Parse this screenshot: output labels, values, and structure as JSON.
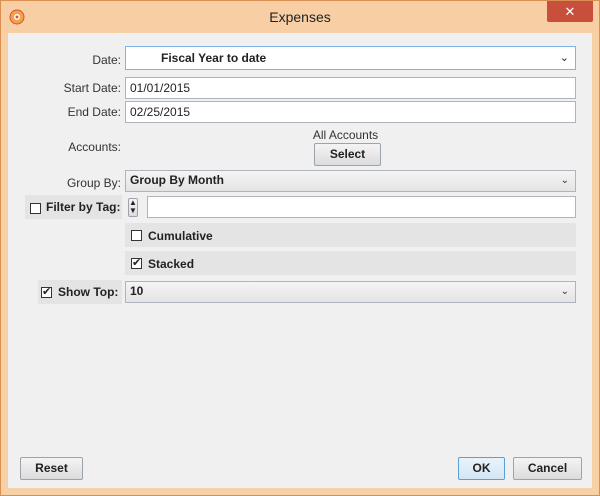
{
  "window": {
    "title": "Expenses",
    "close_glyph": "✕"
  },
  "form": {
    "date_label": "Date:",
    "date_value": "Fiscal Year to date",
    "start_label": "Start Date:",
    "start_value": "01/01/2015",
    "end_label": "End Date:",
    "end_value": "02/25/2015",
    "accounts_label": "Accounts:",
    "accounts_value": "All Accounts",
    "select_label": "Select",
    "group_label": "Group By:",
    "group_value": "Group By Month",
    "filter_tag_label": "Filter by Tag:",
    "filter_tag_checked": false,
    "tag_value": "",
    "cumulative_label": "Cumulative",
    "cumulative_checked": false,
    "stacked_label": "Stacked",
    "stacked_checked": true,
    "show_top_label": "Show Top:",
    "show_top_checked": true,
    "show_top_value": "10"
  },
  "buttons": {
    "reset": "Reset",
    "ok": "OK",
    "cancel": "Cancel"
  },
  "icons": {
    "app": "app-icon",
    "dropdown": "chevron-down-icon",
    "spinner": "spinner-icon",
    "check": "✔"
  },
  "colors": {
    "titlebar": "#f8cfa4",
    "close": "#c74f3c",
    "client": "#f0f0f0"
  }
}
